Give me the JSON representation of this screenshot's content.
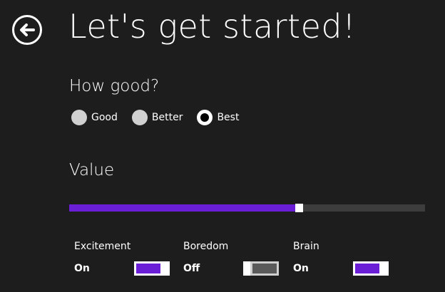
{
  "header": {
    "title": "Let's get started!",
    "back_icon": "back-arrow-circle-icon"
  },
  "quality": {
    "heading": "How good?",
    "options": [
      {
        "label": "Good",
        "selected": false
      },
      {
        "label": "Better",
        "selected": false
      },
      {
        "label": "Best",
        "selected": true
      }
    ]
  },
  "value": {
    "heading": "Value",
    "slider_fraction": 0.65
  },
  "toggles": [
    {
      "label": "Excitement",
      "state": "On",
      "on": true
    },
    {
      "label": "Boredom",
      "state": "Off",
      "on": false
    },
    {
      "label": "Brain",
      "state": "On",
      "on": true
    }
  ],
  "colors": {
    "background": "#1d1d1d",
    "accent": "#6a1fd6",
    "track": "#3d3d3d",
    "text": "#ffffff"
  }
}
